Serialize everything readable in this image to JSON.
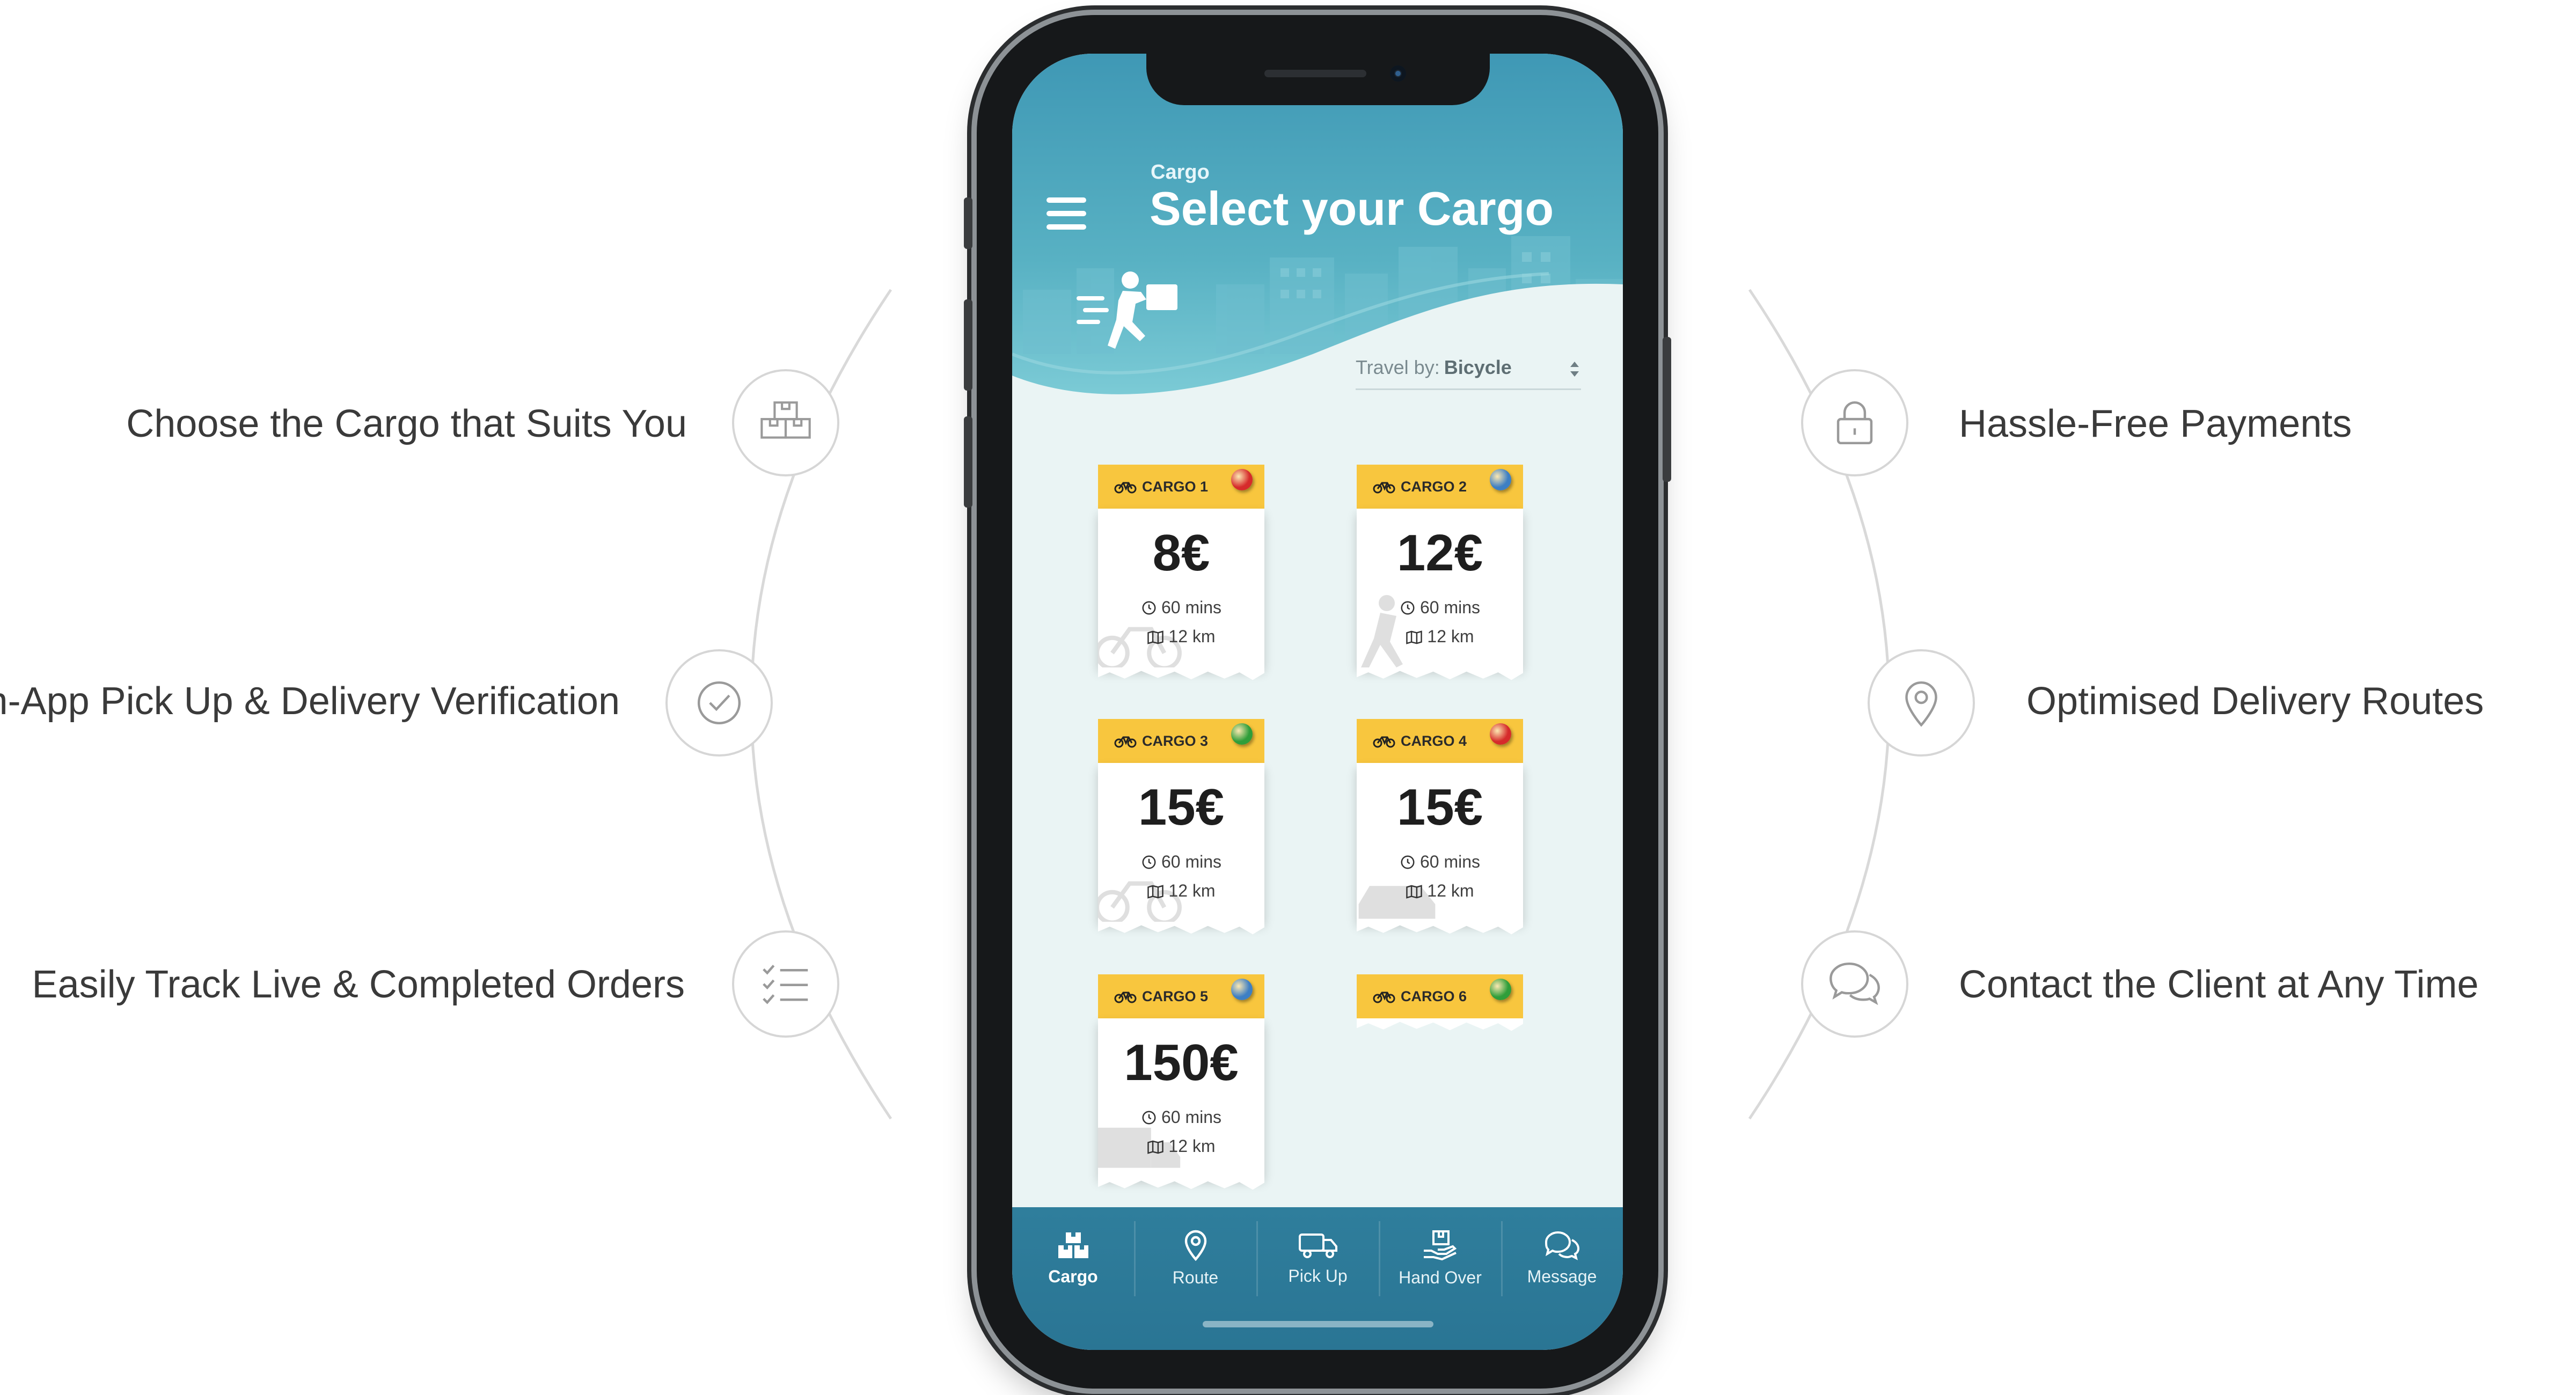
{
  "features": {
    "left": [
      {
        "label": "Choose the Cargo that Suits You",
        "icon": "boxes-icon"
      },
      {
        "label": "In-App Pick Up & Delivery Verification",
        "icon": "check-circle-icon"
      },
      {
        "label": "Easily Track Live & Completed Orders",
        "icon": "checklist-icon"
      }
    ],
    "right": [
      {
        "label": "Hassle-Free Payments",
        "icon": "lock-icon"
      },
      {
        "label": "Optimised Delivery Routes",
        "icon": "location-pin-icon"
      },
      {
        "label": "Contact the Client at Any Time",
        "icon": "chat-bubbles-icon"
      }
    ]
  },
  "app": {
    "header": {
      "eyebrow": "Cargo",
      "title": "Select your Cargo"
    },
    "travel": {
      "label": "Travel by:",
      "value": "Bicycle"
    },
    "cargos": [
      {
        "name": "CARGO 1",
        "price": "8€",
        "time": "60 mins",
        "distance": "12 km",
        "pin_color": "#d62b2b"
      },
      {
        "name": "CARGO 2",
        "price": "12€",
        "time": "60 mins",
        "distance": "12 km",
        "pin_color": "#3d7fc4"
      },
      {
        "name": "CARGO 3",
        "price": "15€",
        "time": "60 mins",
        "distance": "12 km",
        "pin_color": "#2f9e3a"
      },
      {
        "name": "CARGO 4",
        "price": "15€",
        "time": "60 mins",
        "distance": "12 km",
        "pin_color": "#d62b2b"
      },
      {
        "name": "CARGO 5",
        "price": "150€",
        "time": "60 mins",
        "distance": "12 km",
        "pin_color": "#3d7fc4"
      },
      {
        "name": "CARGO 6",
        "pin_color": "#2f9e3a"
      }
    ],
    "tabs": [
      {
        "label": "Cargo",
        "icon": "cargo-boxes-icon",
        "active": true
      },
      {
        "label": "Route",
        "icon": "route-pin-icon"
      },
      {
        "label": "Pick Up",
        "icon": "truck-icon"
      },
      {
        "label": "Hand Over",
        "icon": "hand-package-icon"
      },
      {
        "label": "Message",
        "icon": "message-icon"
      }
    ]
  },
  "colors": {
    "accent_yellow": "#f8c63e",
    "header_teal": "#4aa3bd",
    "tabbar": "#2c7a98"
  }
}
